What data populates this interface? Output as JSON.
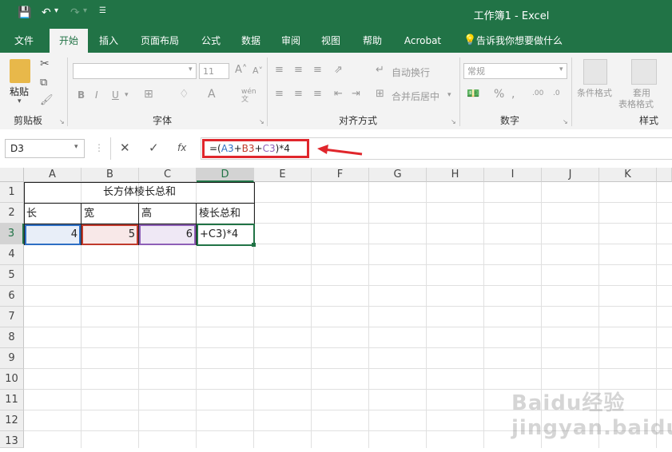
{
  "window": {
    "title": "工作簿1  -  Excel"
  },
  "tabs": [
    "文件",
    "开始",
    "插入",
    "页面布局",
    "公式",
    "数据",
    "审阅",
    "视图",
    "帮助",
    "Acrobat"
  ],
  "tell_me": "告诉我你想要做什么",
  "ribbon": {
    "paste_label": "粘贴",
    "font_name": "",
    "font_size": "11",
    "wen_label": "wén",
    "wrap_label": "自动换行",
    "merge_label": "合并后居中",
    "number_format": "常规",
    "cond_format": "条件格式",
    "table_format_1": "套用",
    "table_format_2": "表格格式",
    "groups": {
      "clipboard": "剪贴板",
      "font": "字体",
      "alignment": "对齐方式",
      "number": "数字",
      "styles": "样式"
    }
  },
  "formula_bar": {
    "name_box": "D3",
    "fx": "fx",
    "formula": "=(A3+B3+C3)*4"
  },
  "columns": [
    "A",
    "B",
    "C",
    "D",
    "E",
    "F",
    "G",
    "H",
    "I",
    "J",
    "K"
  ],
  "rows": [
    "1",
    "2",
    "3",
    "4",
    "5",
    "6",
    "7",
    "8",
    "9",
    "10",
    "11",
    "12",
    "13"
  ],
  "cells": {
    "title": "长方体棱长总和",
    "a2": "长",
    "b2": "宽",
    "c2": "高",
    "d2": "棱长总和",
    "a3": "4",
    "b3": "5",
    "c3": "6",
    "d3": "+C3)*4"
  },
  "colors": {
    "excel_green": "#217346",
    "highlight_red": "#e0262c",
    "ref_blue": "#2e6fc4",
    "ref_red": "#c0392b",
    "ref_purple": "#8e5fb7"
  },
  "watermark": "Baidu经验 jingyan.baidu.com"
}
